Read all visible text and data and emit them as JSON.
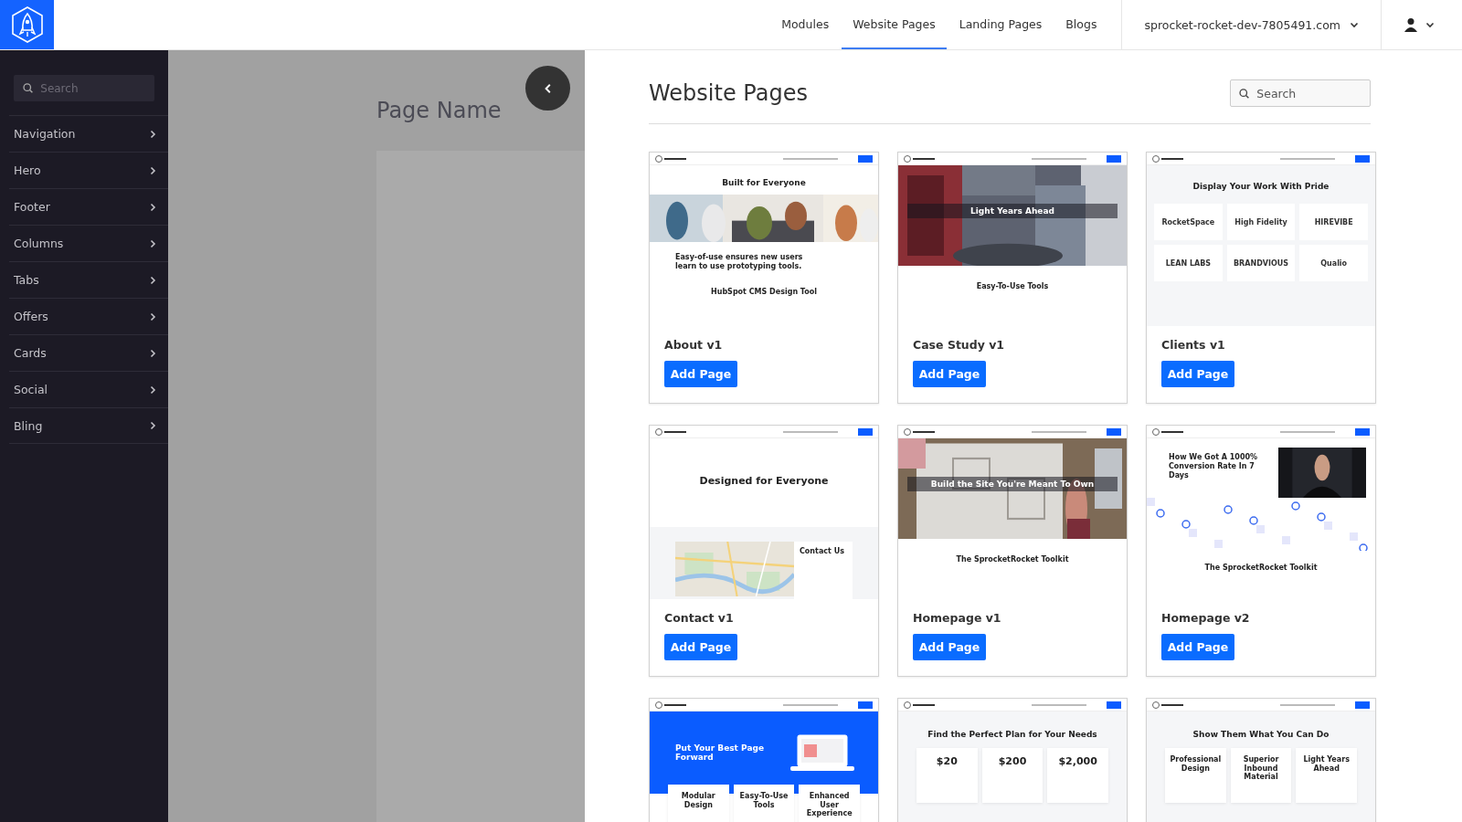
{
  "nav": [
    {
      "label": "Modules",
      "selected": false
    },
    {
      "label": "Website Pages",
      "selected": true
    },
    {
      "label": "Landing Pages",
      "selected": false
    },
    {
      "label": "Blogs",
      "selected": false
    }
  ],
  "domain": "sprocket-rocket-dev-7805491.com",
  "sidebar": {
    "search_placeholder": "Search",
    "items": [
      "Navigation",
      "Hero",
      "Footer",
      "Columns",
      "Tabs",
      "Offers",
      "Cards",
      "Social",
      "Bling"
    ]
  },
  "editor": {
    "page_name": "Page Name"
  },
  "content": {
    "title": "Website Pages",
    "search_placeholder": "Search",
    "templates": [
      {
        "name": "About v1",
        "button": "Add Page",
        "preview": {
          "kind": "photo-strip",
          "heading": "Built for Everyone",
          "subheading": "Easy-of-use ensures new users learn to use prototyping tools.",
          "footer_heading": "HubSpot CMS Design Tool"
        }
      },
      {
        "name": "Case Study v1",
        "button": "Add Page",
        "preview": {
          "kind": "photo-hero",
          "heading": "Light Years Ahead",
          "footer_heading": "Easy-To-Use Tools"
        }
      },
      {
        "name": "Clients v1",
        "button": "Add Page",
        "preview": {
          "kind": "logos",
          "heading": "Display Your Work With Pride",
          "items": [
            "RocketSpace",
            "High Fidelity",
            "HIREVIBE",
            "LEAN LABS",
            "BRANDVIOUS",
            "Qualio"
          ]
        }
      },
      {
        "name": "Contact v1",
        "button": "Add Page",
        "preview": {
          "kind": "map",
          "heading": "Designed for Everyone",
          "footer_heading": "Contact Us"
        }
      },
      {
        "name": "Homepage v1",
        "button": "Add Page",
        "preview": {
          "kind": "photo-hero",
          "heading": "Build the Site You're Meant To Own",
          "footer_heading": "The SprocketRocket Toolkit"
        }
      },
      {
        "name": "Homepage v2",
        "button": "Add Page",
        "preview": {
          "kind": "video",
          "heading": "How We Got A 1000% Conversion Rate In 7 Days",
          "footer_heading": "The SprocketRocket Toolkit"
        }
      },
      {
        "preview": {
          "kind": "blue-hero",
          "heading": "Put Your Best Page Forward",
          "items": [
            "Modular Design",
            "Easy-To-Use Tools",
            "Enhanced User Experience"
          ]
        }
      },
      {
        "preview": {
          "kind": "cards",
          "heading": "Find the Perfect Plan for Your Needs",
          "items": [
            "$20",
            "$200",
            "$2,000"
          ]
        }
      },
      {
        "preview": {
          "kind": "cards",
          "heading": "Show Them What You Can Do",
          "items": [
            "Professional Design",
            "Superior Inbound Material",
            "Light Years Ahead"
          ]
        }
      }
    ]
  }
}
